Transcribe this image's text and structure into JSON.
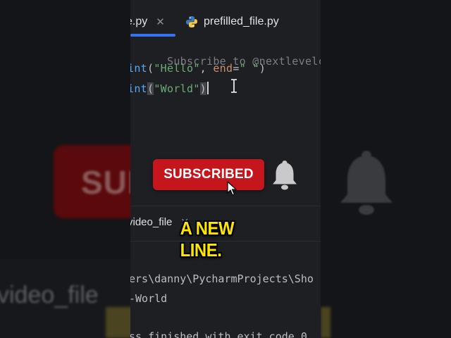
{
  "editor_tabs": {
    "active_tab_label": "e.py",
    "second_tab_label": "prefilled_file.py"
  },
  "code": {
    "line1": "Subscribe to @nextlevelcodinga",
    "line2": {
      "prefix": "int",
      "open": "(",
      "str1": "\"Hello\"",
      "comma": ", ",
      "kw": "end",
      "eq": "=",
      "str2": "\" \"",
      "close": ")"
    },
    "line3": {
      "prefix": "int",
      "open": "(",
      "str1": "\"World\"",
      "close": ")"
    }
  },
  "run_panel": {
    "tab_label": "video_file",
    "console_lines": [
      "ers\\danny\\PycharmProjects\\Sho",
      "-World",
      "ss finished with exit code 0"
    ]
  },
  "overlay": {
    "subscribe_label": "SUBSCRIBED",
    "caption": "A NEW LINE."
  },
  "background": {
    "left_blur_text": "SUI",
    "left_blur_video_text": "video_file"
  },
  "colors": {
    "subscribe_red": "#c4161c",
    "caption_yellow": "#ffe600",
    "editor_bg": "#1e1f22",
    "tab_accent": "#3574f0"
  },
  "icons": [
    "python-file-icon",
    "bell-icon",
    "mouse-pointer-icon",
    "text-cursor-icon",
    "close-icon"
  ]
}
